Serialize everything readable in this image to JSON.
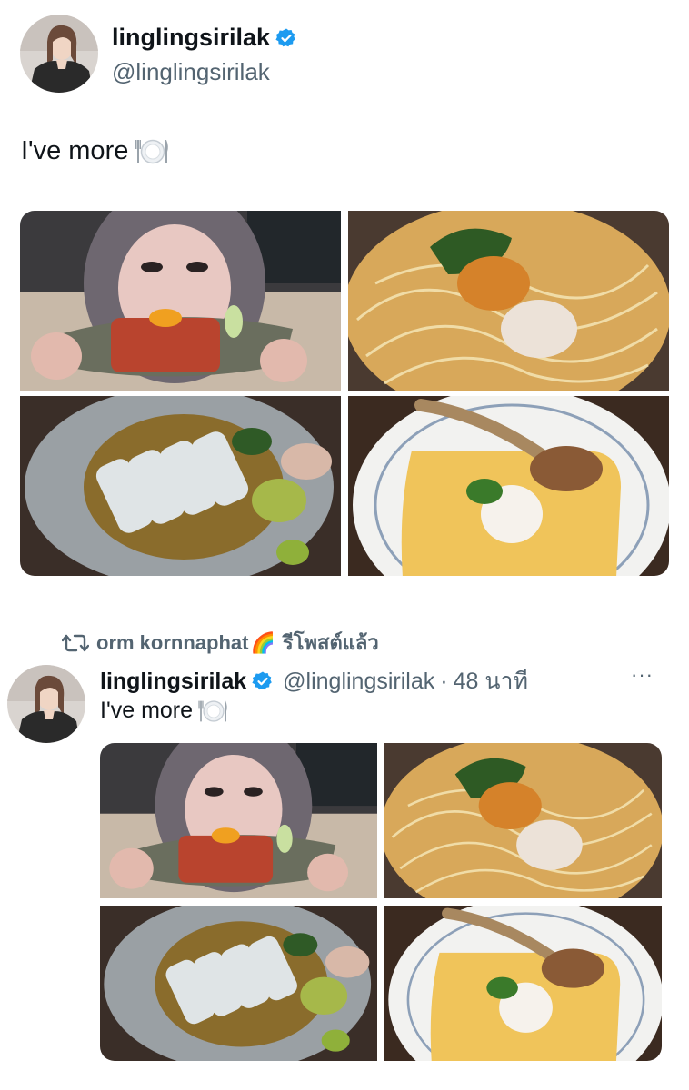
{
  "tweet": {
    "display_name": "linglingsirilak",
    "handle": "@linglingsirilak",
    "text": "I've more",
    "icons": {
      "verified": "verified-badge-icon",
      "plate": "fork-plate-knife-emoji"
    },
    "colors": {
      "verified": "#1d9bf0",
      "text": "#0f1419",
      "secondary": "#536471"
    },
    "photos": [
      "woman-holding-tuna-tartare-photo",
      "uni-pasta-photo",
      "seared-fish-sashimi-photo",
      "tamagoyaki-omelette-photo"
    ]
  },
  "retweet": {
    "retweeter": "orm kornnaphat",
    "rainbow": "🌈",
    "label": "รีโพสต์แล้ว",
    "icon": "retweet-icon"
  },
  "timeline_tweet": {
    "display_name": "linglingsirilak",
    "handle": "@linglingsirilak",
    "separator": "·",
    "time": "48 นาที",
    "text": "I've more",
    "more": "···",
    "icons": {
      "more": "more-options-icon"
    }
  }
}
